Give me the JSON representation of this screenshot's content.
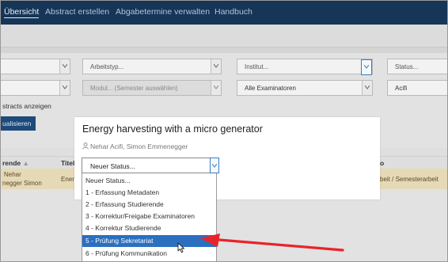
{
  "nav": {
    "items": [
      {
        "label": "Übersicht",
        "active": true
      },
      {
        "label": "Abstract erstellen"
      },
      {
        "label": "Abgabetermine verwalten"
      },
      {
        "label": "Handbuch"
      }
    ]
  },
  "filters": {
    "arbeitstyp": "Arbeitstyp...",
    "institut": "Institut...",
    "status": "Status...",
    "modul": "Modul... (Semester auswählen)",
    "examinatoren": "Alle Examinatoren",
    "person": "Acifi"
  },
  "abstracts_label": "stracts anzeigen",
  "visualize_button": "ualisieren",
  "table": {
    "headers": {
      "studierende": "rende",
      "titel": "Titel",
      "col3": "o"
    },
    "sort_glyph": "▲",
    "row": {
      "name_line1": "Nehar",
      "name_line2": "negger Simon",
      "title_fragment": "Energ",
      "type": "beit / Semesterarbeit"
    }
  },
  "modal": {
    "title": "Energy harvesting with a micro generator",
    "authors": "Nehar Acifi, Simon Emmenegger",
    "status_select": "Neuer Status...",
    "options": [
      "Neuer Status...",
      "1 - Erfassung Metadaten",
      "2 - Erfassung Studierende",
      "3 - Korrektur/Freigabe Examinatoren",
      "4 - Korrektur Studierende",
      "5 - Prüfung Sekretariat",
      "6 - Prüfung Kommunikation"
    ],
    "highlighted_option_index": 5
  },
  "colors": {
    "navbar": "#163557",
    "highlight": "#2a6fc0",
    "arrow": "#e8242a",
    "row": "#e6d9b5"
  }
}
